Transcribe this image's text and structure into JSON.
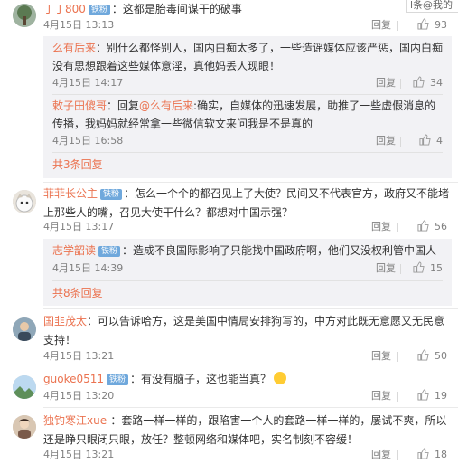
{
  "top_fragment": "l条@我的",
  "colors": {
    "username": "#eb7350",
    "meta": "#808080",
    "badge": "#6fa8dc"
  },
  "comments": [
    {
      "username": "丁丁800",
      "badge": "铁粉",
      "text": "：这都是胎毒间谋干的破事",
      "date": "4月15日 13:13",
      "reply_label": "回复",
      "likes": "93",
      "avatar_icon": "tree-avatar-icon"
    },
    {
      "replies": [
        {
          "username": "么有后来",
          "text": "：别什么都怪别人，国内白痴太多了，一些造谣媒体应该严惩，国内白痴没有思想跟着这些媒体意淫，真他妈丢人现眼！",
          "date": "4月15日 14:17",
          "reply_label": "回复",
          "likes": "34"
        },
        {
          "username": "敕子田傻哥",
          "text": "：回复@么有后来:确实，自媒体的迅速发展，助推了一些虚假消息的传播，我妈妈就经常拿一些微信软文来问我是不是真的",
          "mention": "@么有后来",
          "date": "4月15日 16:58",
          "reply_label": "回复",
          "likes": "4"
        }
      ],
      "more_label": "共3条回复"
    },
    {
      "username": "菲菲长公主",
      "badge": "铁粉",
      "text": "：怎么一个个的都召见上了大使？民间又不代表官方，政府又不能堵上那些人的嘴，召见大使干什么？都想对中国示强？",
      "date": "4月15日 13:17",
      "reply_label": "回复",
      "likes": "56",
      "avatar_icon": "cat-avatar-icon"
    },
    {
      "replies": [
        {
          "username": "志学韶读",
          "badge": "铁粉",
          "text": "：造成不良国际影响了只能找中国政府啊，他们又没权利管中国人",
          "date": "4月15日 14:39",
          "reply_label": "回复",
          "likes": "15"
        }
      ],
      "more_label": "共8条回复"
    },
    {
      "username": "国韭茂太",
      "text": "：可以告诉哈方，这是美国中情局安排狗写的，中方对此既无意愿又无民意支持！",
      "date": "4月15日 13:21",
      "reply_label": "回复",
      "likes": "50",
      "avatar_icon": "person-avatar-icon"
    },
    {
      "username": "guoke0511",
      "badge": "铁粉",
      "text": "：有没有脑子，这也能当真？",
      "date": "4月15日 13:20",
      "reply_label": "回复",
      "likes": "19",
      "avatar_icon": "landscape-avatar-icon"
    },
    {
      "username": "独钓寒江xue-",
      "text": "：套路一样一样的，跟陷害一个人的套路一样一样的，屡试不爽，所以还是睁只眼闭只眼，放任？整顿网络和媒体吧，实名制刻不容缓！",
      "date": "4月15日 13:21",
      "reply_label": "回复",
      "likes": "18",
      "avatar_icon": "portrait-avatar-icon"
    }
  ]
}
